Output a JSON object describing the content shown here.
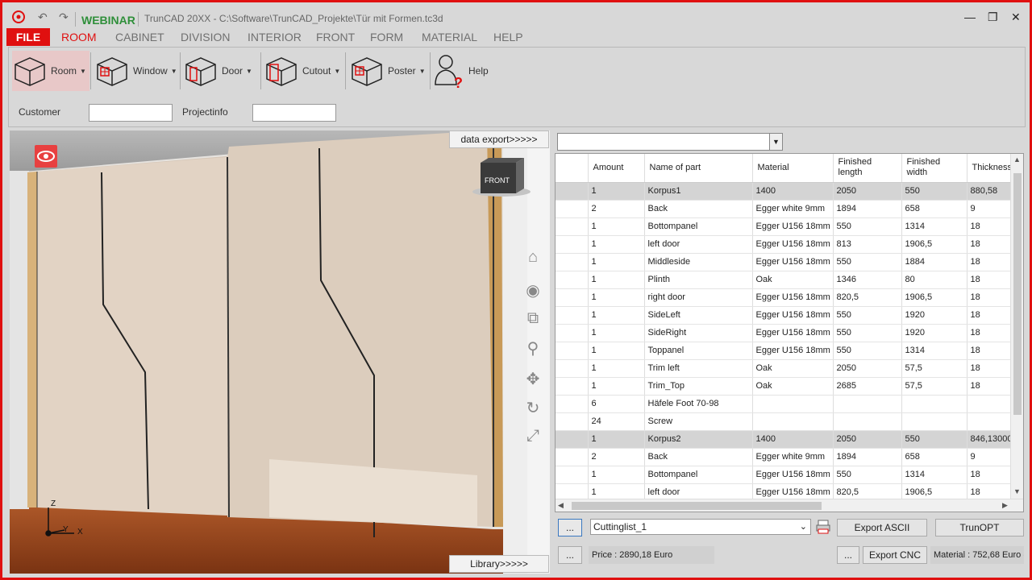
{
  "titlebar": {
    "app_name": "WEBINAR",
    "window_title": "TrunCAD 20XX - C:\\Software\\TrunCAD_Projekte\\Tür mit Formen.tc3d",
    "undo_icon": "undo-icon",
    "redo_icon": "redo-icon"
  },
  "menu": {
    "file": "FILE",
    "items": [
      "ROOM",
      "CABINET",
      "DIVISION",
      "INTERIOR",
      "FRONT",
      "FORM",
      "MATERIAL",
      "HELP"
    ]
  },
  "ribbon": {
    "buttons": [
      {
        "label": "Room",
        "icon": "room-icon"
      },
      {
        "label": "Window",
        "icon": "window-icon"
      },
      {
        "label": "Door",
        "icon": "door-icon"
      },
      {
        "label": "Cutout",
        "icon": "cutout-icon"
      },
      {
        "label": "Poster",
        "icon": "poster-icon"
      },
      {
        "label": "Help",
        "icon": "help-person-icon"
      }
    ],
    "customer_label": "Customer",
    "customer_value": "",
    "projectinfo_label": "Projectinfo",
    "projectinfo_value": ""
  },
  "viewport": {
    "data_export": "data export>>>>>",
    "library": "Library>>>>>",
    "viewcube_label": "FRONT",
    "axis_z": "Z",
    "axis_y": "Y",
    "axis_x": "X"
  },
  "cuttinglist": {
    "columns": [
      "Amount",
      "Name of part",
      "Material",
      "Finished length",
      "Finished width",
      "Thickness"
    ],
    "rows": [
      {
        "group": true,
        "cells": [
          "1",
          "Korpus1",
          "1400",
          "2050",
          "550",
          "880,58"
        ]
      },
      {
        "group": false,
        "cells": [
          "2",
          "Back",
          "Egger white 9mm",
          "1894",
          "658",
          "9"
        ]
      },
      {
        "group": false,
        "cells": [
          "1",
          "Bottompanel",
          "Egger U156 18mm",
          "550",
          "1314",
          "18"
        ]
      },
      {
        "group": false,
        "cells": [
          "1",
          "left door",
          "Egger U156 18mm",
          "813",
          "1906,5",
          "18"
        ]
      },
      {
        "group": false,
        "cells": [
          "1",
          "Middleside",
          "Egger U156 18mm",
          "550",
          "1884",
          "18"
        ]
      },
      {
        "group": false,
        "cells": [
          "1",
          "Plinth",
          "Oak",
          "1346",
          "80",
          "18"
        ]
      },
      {
        "group": false,
        "cells": [
          "1",
          "right door",
          "Egger U156 18mm",
          "820,5",
          "1906,5",
          "18"
        ]
      },
      {
        "group": false,
        "cells": [
          "1",
          "SideLeft",
          "Egger U156 18mm",
          "550",
          "1920",
          "18"
        ]
      },
      {
        "group": false,
        "cells": [
          "1",
          "SideRight",
          "Egger U156 18mm",
          "550",
          "1920",
          "18"
        ]
      },
      {
        "group": false,
        "cells": [
          "1",
          "Toppanel",
          "Egger U156 18mm",
          "550",
          "1314",
          "18"
        ]
      },
      {
        "group": false,
        "cells": [
          "1",
          "Trim left",
          "Oak",
          "2050",
          "57,5",
          "18"
        ]
      },
      {
        "group": false,
        "cells": [
          "1",
          "Trim_Top",
          "Oak",
          "2685",
          "57,5",
          "18"
        ]
      },
      {
        "group": false,
        "cells": [
          "6",
          "Häfele Foot 70-98",
          "",
          "",
          "",
          ""
        ]
      },
      {
        "group": false,
        "cells": [
          "24",
          "Screw",
          "",
          "",
          "",
          ""
        ]
      },
      {
        "group": true,
        "cells": [
          "1",
          "Korpus2",
          "1400",
          "2050",
          "550",
          "846,13000"
        ]
      },
      {
        "group": false,
        "cells": [
          "2",
          "Back",
          "Egger white 9mm",
          "1894",
          "658",
          "9"
        ]
      },
      {
        "group": false,
        "cells": [
          "1",
          "Bottompanel",
          "Egger U156 18mm",
          "550",
          "1314",
          "18"
        ]
      },
      {
        "group": false,
        "cells": [
          "1",
          "left door",
          "Egger U156 18mm",
          "820,5",
          "1906,5",
          "18"
        ]
      }
    ]
  },
  "bottom": {
    "dots": "...",
    "list_select": "Cuttinglist_1",
    "export_ascii": "Export ASCII",
    "trunopt": "TrunOPT",
    "price": "Price : 2890,18 Euro",
    "export_cnc": "Export CNC",
    "material": "Material : 752,68 Euro ("
  },
  "colors": {
    "accent": "#e01010",
    "brand_green": "#2f8f3a"
  }
}
